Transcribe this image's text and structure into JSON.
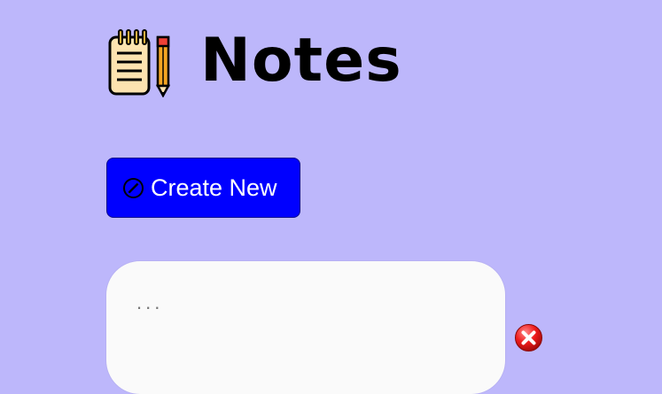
{
  "header": {
    "title": "Notes",
    "logo_icon": "notepad-pencil-icon"
  },
  "toolbar": {
    "create_label": "Create New",
    "create_icon": "pencil-circle-icon"
  },
  "notes": [
    {
      "value": "",
      "placeholder": "...",
      "delete_icon": "close-icon"
    }
  ],
  "colors": {
    "background": "#bdb7fb",
    "button": "#0000ff",
    "card": "#fafafa",
    "delete": "#e3101c"
  }
}
